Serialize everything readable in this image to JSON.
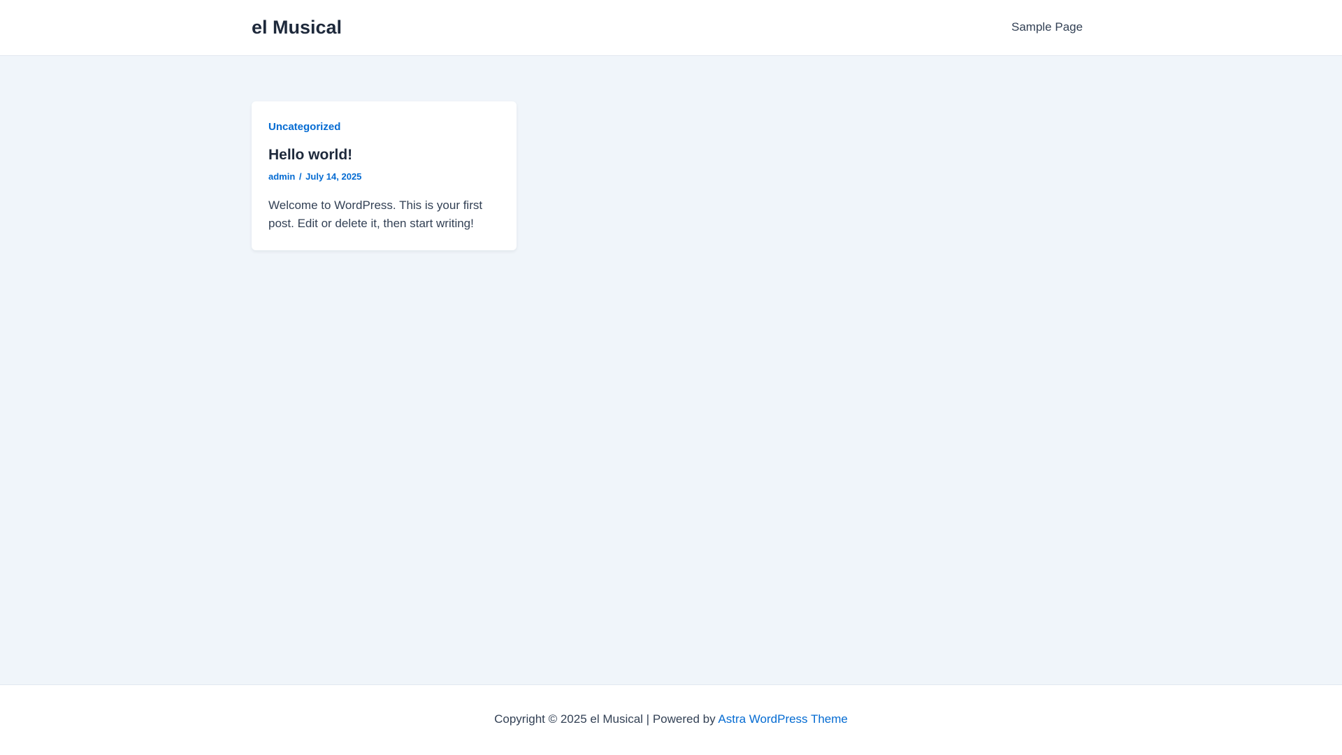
{
  "header": {
    "site_title": "el Musical",
    "nav": {
      "sample_page": "Sample Page"
    }
  },
  "post": {
    "category": "Uncategorized",
    "title": "Hello world!",
    "author": "admin",
    "separator": "/",
    "date": "July 14, 2025",
    "excerpt": "Welcome to WordPress. This is your first post. Edit or delete it, then start writing!"
  },
  "footer": {
    "copyright": "Copyright © 2025 el Musical | Powered by",
    "theme_link": "Astra WordPress Theme"
  },
  "colors": {
    "page_background": "#f0f5fa",
    "surface": "#ffffff",
    "heading_text": "#1e293b",
    "body_text": "#334155",
    "link_accent": "#046bd2",
    "border": "#e2e8f0"
  }
}
